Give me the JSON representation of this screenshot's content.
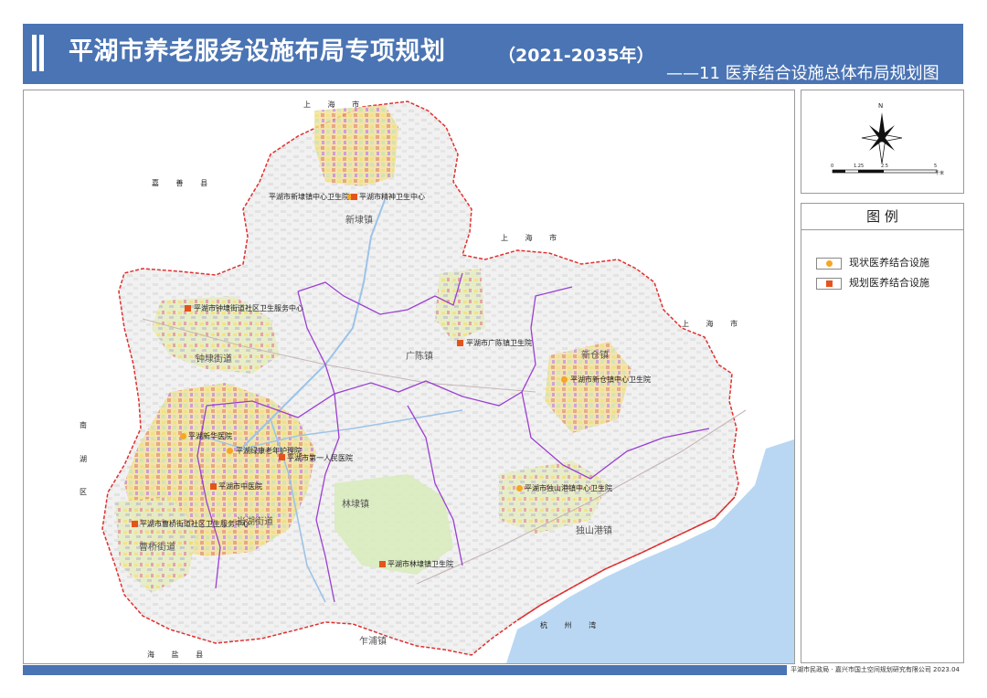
{
  "header": {
    "title": "平湖市养老服务设施布局专项规划",
    "years": "（2021-2035年）",
    "subtitle": "——11 医养结合设施总体布局规划图"
  },
  "map": {
    "regions": {
      "shanghai_top": "上 海 市",
      "shanghai_mid": "上 海 市",
      "shanghai_right": "上 海 市",
      "jiashan": "嘉 善 县",
      "nanhu_1": "南",
      "nanhu_2": "湖",
      "nanhu_3": "区",
      "haiyan": "海 盐 县",
      "hangzhou_bay": "杭 州 湾"
    },
    "towns": {
      "xindai": "新埭镇",
      "guangchen": "广陈镇",
      "xincang": "新仓镇",
      "zhongdai": "钟埭街道",
      "danghu": "当湖街道",
      "linda": "林埭镇",
      "caoqiao": "曹桥街道",
      "dushangang": "独山港镇",
      "zhapu": "乍浦镇"
    },
    "facilities": [
      {
        "name": "平湖市新埭镇中心卫生院",
        "status": "current"
      },
      {
        "name": "平湖市精神卫生中心",
        "status": "planned"
      },
      {
        "name": "平湖市钟埭街道社区卫生服务中心",
        "status": "planned"
      },
      {
        "name": "平湖市广陈镇卫生院",
        "status": "planned"
      },
      {
        "name": "平湖市新仓镇中心卫生院",
        "status": "current"
      },
      {
        "name": "平湖新华医院",
        "status": "current"
      },
      {
        "name": "平湖绿康老年护理院",
        "status": "current"
      },
      {
        "name": "平湖市第一人民医院",
        "status": "planned"
      },
      {
        "name": "平湖市中医院",
        "status": "planned"
      },
      {
        "name": "平湖市独山港镇中心卫生院",
        "status": "current"
      },
      {
        "name": "平湖市曹桥街道社区卫生服务中心",
        "status": "planned"
      },
      {
        "name": "平湖市林埭镇卫生院",
        "status": "planned"
      }
    ]
  },
  "compass": {
    "north": "N",
    "scale_ticks": [
      "0",
      "1.25",
      "2.5",
      "5"
    ],
    "scale_unit": "千米"
  },
  "legend": {
    "title": "图 例",
    "items": [
      {
        "label": "现状医养结合设施",
        "color": "#f5a623"
      },
      {
        "label": "规划医养结合设施",
        "color": "#e5531c"
      }
    ]
  },
  "footer": {
    "credit": "平湖市民政局 · 嘉兴市国土空间规划研究有限公司 2023.04"
  },
  "colors": {
    "header_bg": "#4a74b4",
    "sea": "#b9d7f2",
    "boundary": "#e03030",
    "district_line": "#9b3fd1",
    "current_marker": "#f5a623",
    "planned_marker": "#e5531c"
  }
}
